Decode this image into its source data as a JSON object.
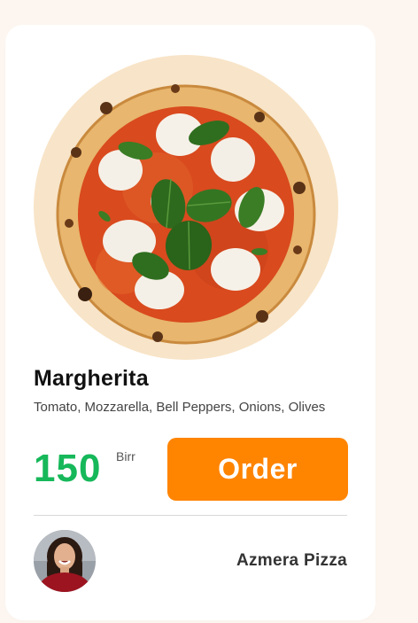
{
  "product": {
    "name": "Margherita",
    "ingredients": "Tomato, Mozzarella, Bell Peppers, Onions, Olives",
    "price": "150",
    "currency": "Birr"
  },
  "actions": {
    "order_label": "Order"
  },
  "seller": {
    "name": "Azmera Pizza"
  },
  "colors": {
    "page_background": "#fdf6f0",
    "card_background": "#ffffff",
    "price_green": "#16b85a",
    "order_orange": "#ff8400",
    "pizza_backdrop": "#f8e4c8"
  },
  "icons": {
    "product_image": "pizza-image",
    "seller_avatar": "avatar"
  }
}
